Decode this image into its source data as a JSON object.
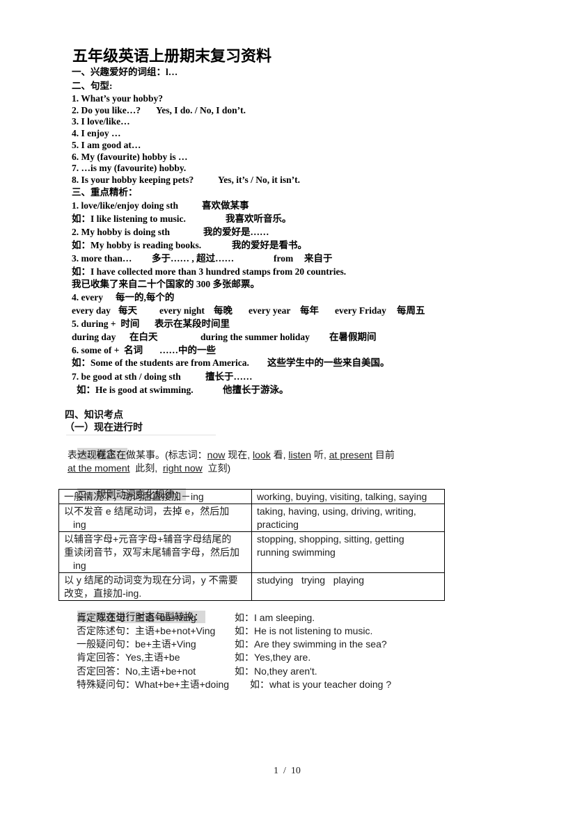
{
  "document": {
    "title": "五年级英语上册期末复习资料",
    "part1": {
      "heading": "一、兴趣爱好的词组：l…"
    },
    "part2": {
      "heading": "二、句型:",
      "items": [
        {
          "text": "1. What’s your hobby?"
        },
        {
          "text": "2. Do you like…?",
          "answer": "Yes, I do. / No, I don’t."
        },
        {
          "text": "3. I love/like…"
        },
        {
          "text": "4. I enjoy …"
        },
        {
          "text": "5. I am good at…"
        },
        {
          "text": "6. My (favourite) hobby is …"
        },
        {
          "text": "7. …is my (favourite) hobby."
        },
        {
          "text": "8. Is your hobby keeping pets?",
          "answer": "Yes, it’s / No, it isn’t."
        }
      ]
    },
    "part3": {
      "heading": "三、重点精析：",
      "points": [
        {
          "phrase": "1. love/like/enjoy doing sth",
          "meaning": "喜欢做某事",
          "example": "如：I like listening to music.",
          "example_cn": "我喜欢听音乐。"
        },
        {
          "phrase": "2. My hobby is doing sth",
          "meaning": "我的爱好是……",
          "example": "如：My hobby is reading books.",
          "example_cn": "我的爱好是看书。"
        },
        {
          "phrase": "3. more than…",
          "meaning": "多于…… , 超过……",
          "extra_word": "from",
          "extra_meaning": "来自于",
          "example": "如：I have collected more than 3 hundred stamps from 20 countries.",
          "example_cn": "我已收集了来自二十个国家的 300 多张邮票。"
        },
        {
          "phrase": "4. every",
          "meaning": "每一的,每个的",
          "examples": [
            {
              "en": "every day",
              "cn": "每天"
            },
            {
              "en": "every night",
              "cn": "每晚"
            },
            {
              "en": "every year",
              "cn": "每年"
            },
            {
              "en": "every Friday",
              "cn": "每周五"
            }
          ]
        },
        {
          "phrase": "5. during +  时间",
          "meaning": "表示在某段时间里",
          "examples": [
            {
              "en": "during day",
              "cn": "在白天"
            },
            {
              "en": "during the summer holiday",
              "cn": "在暑假期间"
            }
          ]
        },
        {
          "phrase": "6. some of +  名词",
          "meaning": "……中的一些",
          "example": "如：Some of the students are from America.",
          "example_cn": "这些学生中的一些来自美国。"
        },
        {
          "phrase": "7. be good at sth / doing sth",
          "meaning": "擅长于……",
          "example": "如：He is good at swimming.",
          "example_cn": "他擅长于游泳。"
        }
      ]
    },
    "part4": {
      "heading": "四、知识考点",
      "subheading": "（一）现在进行时",
      "concept": {
        "heading": "一、概念：",
        "intro": "表达现在正在做某事。(标志词：",
        "markers": [
          {
            "word": "now",
            "meaning": " 现在, "
          },
          {
            "word": "look",
            "meaning": " 看, "
          },
          {
            "word": "listen",
            "meaning": " 听, "
          },
          {
            "word": "at present",
            "meaning": " 目前"
          },
          {
            "word": "at the moment",
            "meaning": "  此刻,  "
          },
          {
            "word": "right now",
            "meaning": "  立刻)"
          }
        ]
      },
      "rules": {
        "heading": "二、规则动词变化规律：",
        "rows": [
          {
            "rule": [
              "一般情况下，动词后直接加－ing"
            ],
            "examples": [
              "working, buying, visiting, talking, saying"
            ]
          },
          {
            "rule": [
              "以不发音 e 结尾动词，去掉 e，然后加",
              "ing"
            ],
            "examples": [
              "taking, having, using, driving, writing,",
              "practicing"
            ]
          },
          {
            "rule": [
              "以辅音字母+元音字母+辅音字母结尾的",
              "重读闭音节，双写末尾辅音字母，然后加",
              "ing"
            ],
            "examples": [
              "stopping, shopping, sitting, getting",
              "running swimming"
            ]
          },
          {
            "rule": [
              "以 y 结尾的动词变为现在分词，y 不需要",
              "改变，直接加-ing."
            ],
            "examples": [
              "studying   trying   playing"
            ]
          }
        ]
      },
      "transform": {
        "heading": "三、现在进行时态句型转换：",
        "rows": [
          {
            "pattern": "肯定陈述句：主语+be+Ving",
            "example": "如：I am sleeping."
          },
          {
            "pattern": "否定陈述句：主语+be+not+Ving",
            "example": "如：He is not listening to music."
          },
          {
            "pattern": "一般疑问句：be+主语+Ving",
            "example": "如：Are they swimming in the sea?"
          },
          {
            "pattern": "肯定回答：Yes,主语+be",
            "example": "如：Yes,they are."
          },
          {
            "pattern": "否定回答：No,主语+be+not",
            "example": "如：No,they aren't."
          },
          {
            "pattern": "特殊疑问句：What+be+主语+doing",
            "example": "如：what is your teacher doing ?"
          }
        ]
      }
    }
  },
  "footer": {
    "page": "1  /  10"
  }
}
